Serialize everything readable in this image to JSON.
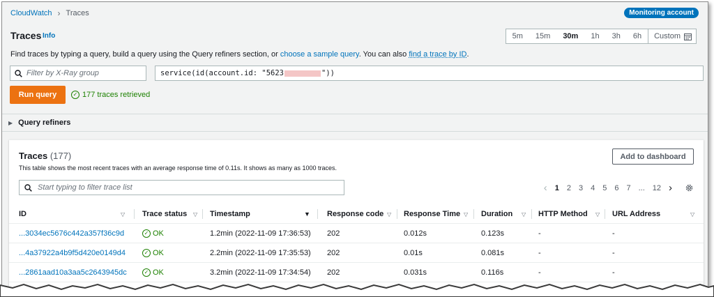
{
  "breadcrumb": {
    "service": "CloudWatch",
    "current": "Traces"
  },
  "account_badge": "Monitoring account",
  "page": {
    "title": "Traces",
    "info": "Info"
  },
  "time_range": {
    "options": [
      "5m",
      "15m",
      "30m",
      "1h",
      "3h",
      "6h"
    ],
    "selected": "30m",
    "custom": "Custom"
  },
  "description": {
    "part1": "Find traces by typing a query, build a query using the Query refiners section, or ",
    "link1": "choose a sample query",
    "part2": ". You can also ",
    "link2": "find a trace by ID",
    "part3": "."
  },
  "group_filter": {
    "placeholder": "Filter by X-Ray group"
  },
  "query": {
    "prefix": "service(id(account.id: \"5623",
    "suffix": "\"))"
  },
  "run_query_label": "Run query",
  "query_status": "177 traces retrieved",
  "query_refiners_label": "Query refiners",
  "traces_panel": {
    "title": "Traces",
    "count": "(177)",
    "description": "This table shows the most recent traces with an average response time of 0.11s. It shows as many as 1000 traces.",
    "add_to_dashboard": "Add to dashboard",
    "filter_placeholder": "Start typing to filter trace list",
    "pagination": {
      "pages": [
        "1",
        "2",
        "3",
        "4",
        "5",
        "6",
        "7",
        "...",
        "12"
      ],
      "current": "1"
    },
    "columns": [
      "ID",
      "Trace status",
      "Timestamp",
      "Response code",
      "Response Time",
      "Duration",
      "HTTP Method",
      "URL Address"
    ],
    "rows": [
      {
        "id": "...3034ec5676c442a357f36c9d",
        "status": "OK",
        "timestamp": "1.2min (2022-11-09 17:36:53)",
        "code": "202",
        "response_time": "0.012s",
        "duration": "0.123s",
        "method": "-",
        "url": "-"
      },
      {
        "id": "...4a37922a4b9f5d420e0149d4",
        "status": "OK",
        "timestamp": "2.2min (2022-11-09 17:35:53)",
        "code": "202",
        "response_time": "0.01s",
        "duration": "0.081s",
        "method": "-",
        "url": "-"
      },
      {
        "id": "...2861aad10a3aa5c2643945dc",
        "status": "OK",
        "timestamp": "3.2min (2022-11-09 17:34:54)",
        "code": "202",
        "response_time": "0.031s",
        "duration": "0.116s",
        "method": "-",
        "url": "-"
      }
    ]
  },
  "colors": {
    "accent": "#0073bb",
    "primary_button": "#ec7211",
    "success": "#1d8102"
  },
  "icons": {
    "search": "search-icon",
    "calendar": "calendar-icon",
    "settings": "gear-icon"
  }
}
